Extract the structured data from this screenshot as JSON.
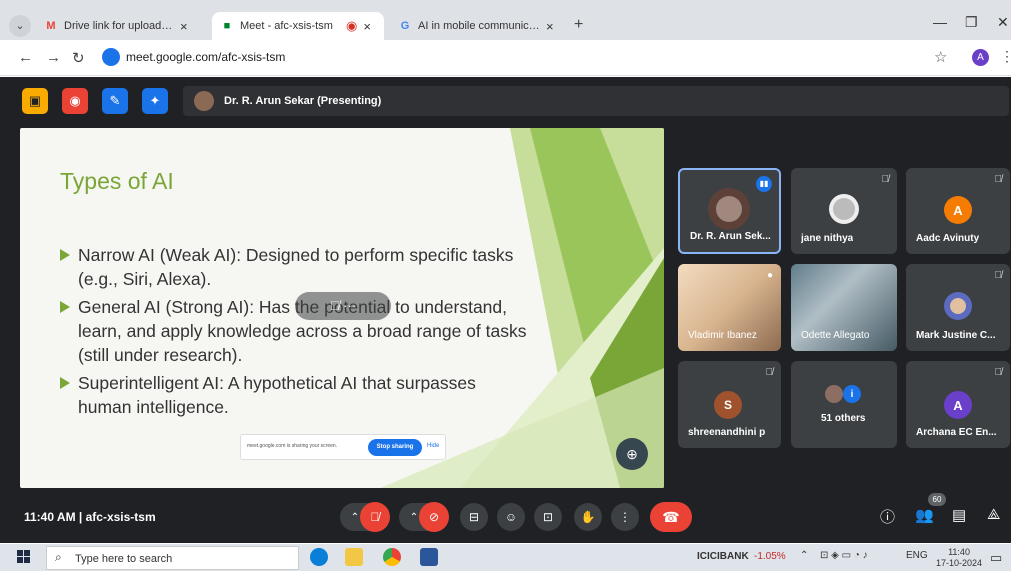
{
  "browser": {
    "tabs": [
      {
        "label": "Drive link for uploading CIA ans",
        "icon": "gmail-icon",
        "active": false
      },
      {
        "label": "Meet - afc-xsis-tsm",
        "icon": "meet-icon",
        "active": true
      },
      {
        "label": "AI in mobile communication - N",
        "icon": "google-icon",
        "active": false
      }
    ],
    "url": "meet.google.com/afc-xsis-tsm",
    "profile_initial": "A"
  },
  "meet": {
    "presenter_label": "Dr. R. Arun Sekar (Presenting)",
    "meeting_id": "11:40 AM  |  afc-xsis-tsm",
    "participant_count": "60",
    "colors": {
      "accent": "#1a73e8",
      "danger": "#ea4335",
      "slide_green": "#7aa637"
    }
  },
  "slide": {
    "title": "Types of AI",
    "bullets": [
      "Narrow AI (Weak AI): Designed to perform specific tasks (e.g., Siri, Alexa).",
      "General AI (Strong AI): Has the potential to understand, learn, and apply knowledge across a broad range of tasks (still under research).",
      "Superintelligent AI: A hypothetical AI that surpasses human intelligence."
    ],
    "share_notice": "meet.google.com is sharing your screen.",
    "stop_sharing_label": "Stop sharing",
    "hide_label": "Hide"
  },
  "participants": [
    {
      "name": "Dr. R. Arun Sek...",
      "type": "photo",
      "speaking": true
    },
    {
      "name": "jane nithya",
      "type": "photo",
      "speaking": false
    },
    {
      "name": "Aadc Avinuty",
      "type": "initial",
      "initial": "A",
      "color": "#f57c00"
    },
    {
      "name": "Vladimir Ibanez",
      "type": "photo",
      "speaking": false
    },
    {
      "name": "Odette Allegato",
      "type": "photo",
      "speaking": false
    },
    {
      "name": "Mark Justine C...",
      "type": "photo",
      "speaking": false
    },
    {
      "name": "shreenandhini p",
      "type": "initial",
      "initial": "S",
      "color": "#a0522d"
    },
    {
      "name": "51 others",
      "type": "group"
    },
    {
      "name": "Archana EC En...",
      "type": "initial",
      "initial": "A",
      "color": "#6a3fc9"
    }
  ],
  "taskbar": {
    "search_placeholder": "Type here to search",
    "stock_name": "ICICIBANK",
    "stock_change": "-1.05%",
    "language": "ENG",
    "time": "11:40",
    "date": "17-10-2024"
  }
}
